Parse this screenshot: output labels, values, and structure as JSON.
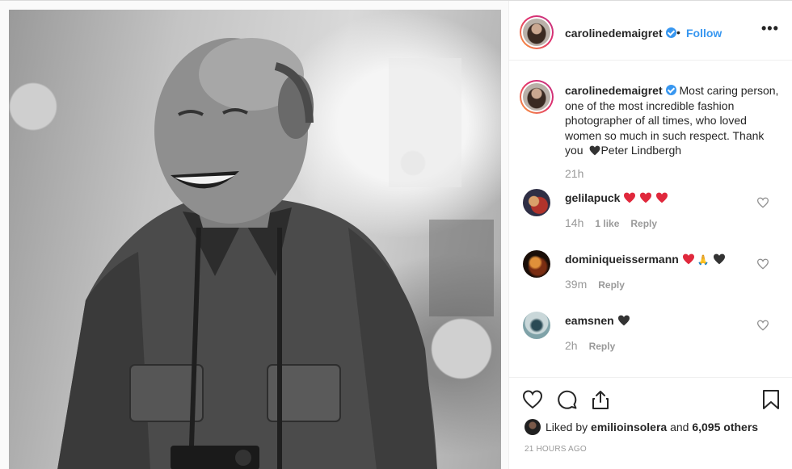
{
  "post": {
    "author": "carolinedemaigret",
    "separator": "•",
    "follow_label": "Follow",
    "more_label": "•••"
  },
  "caption": {
    "username": "carolinedemaigret",
    "text_part1": "Most caring person, one of the most incredible fashion photographer of all times, who loved women so much in such respect. Thank you ",
    "text_part2": "Peter Lindbergh",
    "time": "21h"
  },
  "comments": [
    {
      "username": "gelilapuck",
      "time": "14h",
      "likes": "1 like",
      "reply": "Reply",
      "emoji": [
        "red-heart",
        "red-heart",
        "red-heart"
      ]
    },
    {
      "username": "dominiqueissermann",
      "time": "39m",
      "reply": "Reply",
      "emoji": [
        "red-heart",
        "folded-hands",
        "black-heart"
      ]
    },
    {
      "username": "eamsnen",
      "time": "2h",
      "reply": "Reply",
      "emoji": [
        "black-heart"
      ]
    }
  ],
  "footer": {
    "liked_prefix": "Liked by ",
    "liked_user": "emilioinsolera",
    "liked_mid": " and ",
    "liked_count": "6,095 others",
    "timestamp": "21 HOURS AGO"
  },
  "colors": {
    "accent": "#3897f0",
    "text": "#262626",
    "muted": "#999999",
    "heart": "#ed4956"
  },
  "icons": [
    "heart-icon",
    "comment-icon",
    "share-icon",
    "bookmark-icon",
    "verified-badge-icon",
    "more-options-icon"
  ]
}
